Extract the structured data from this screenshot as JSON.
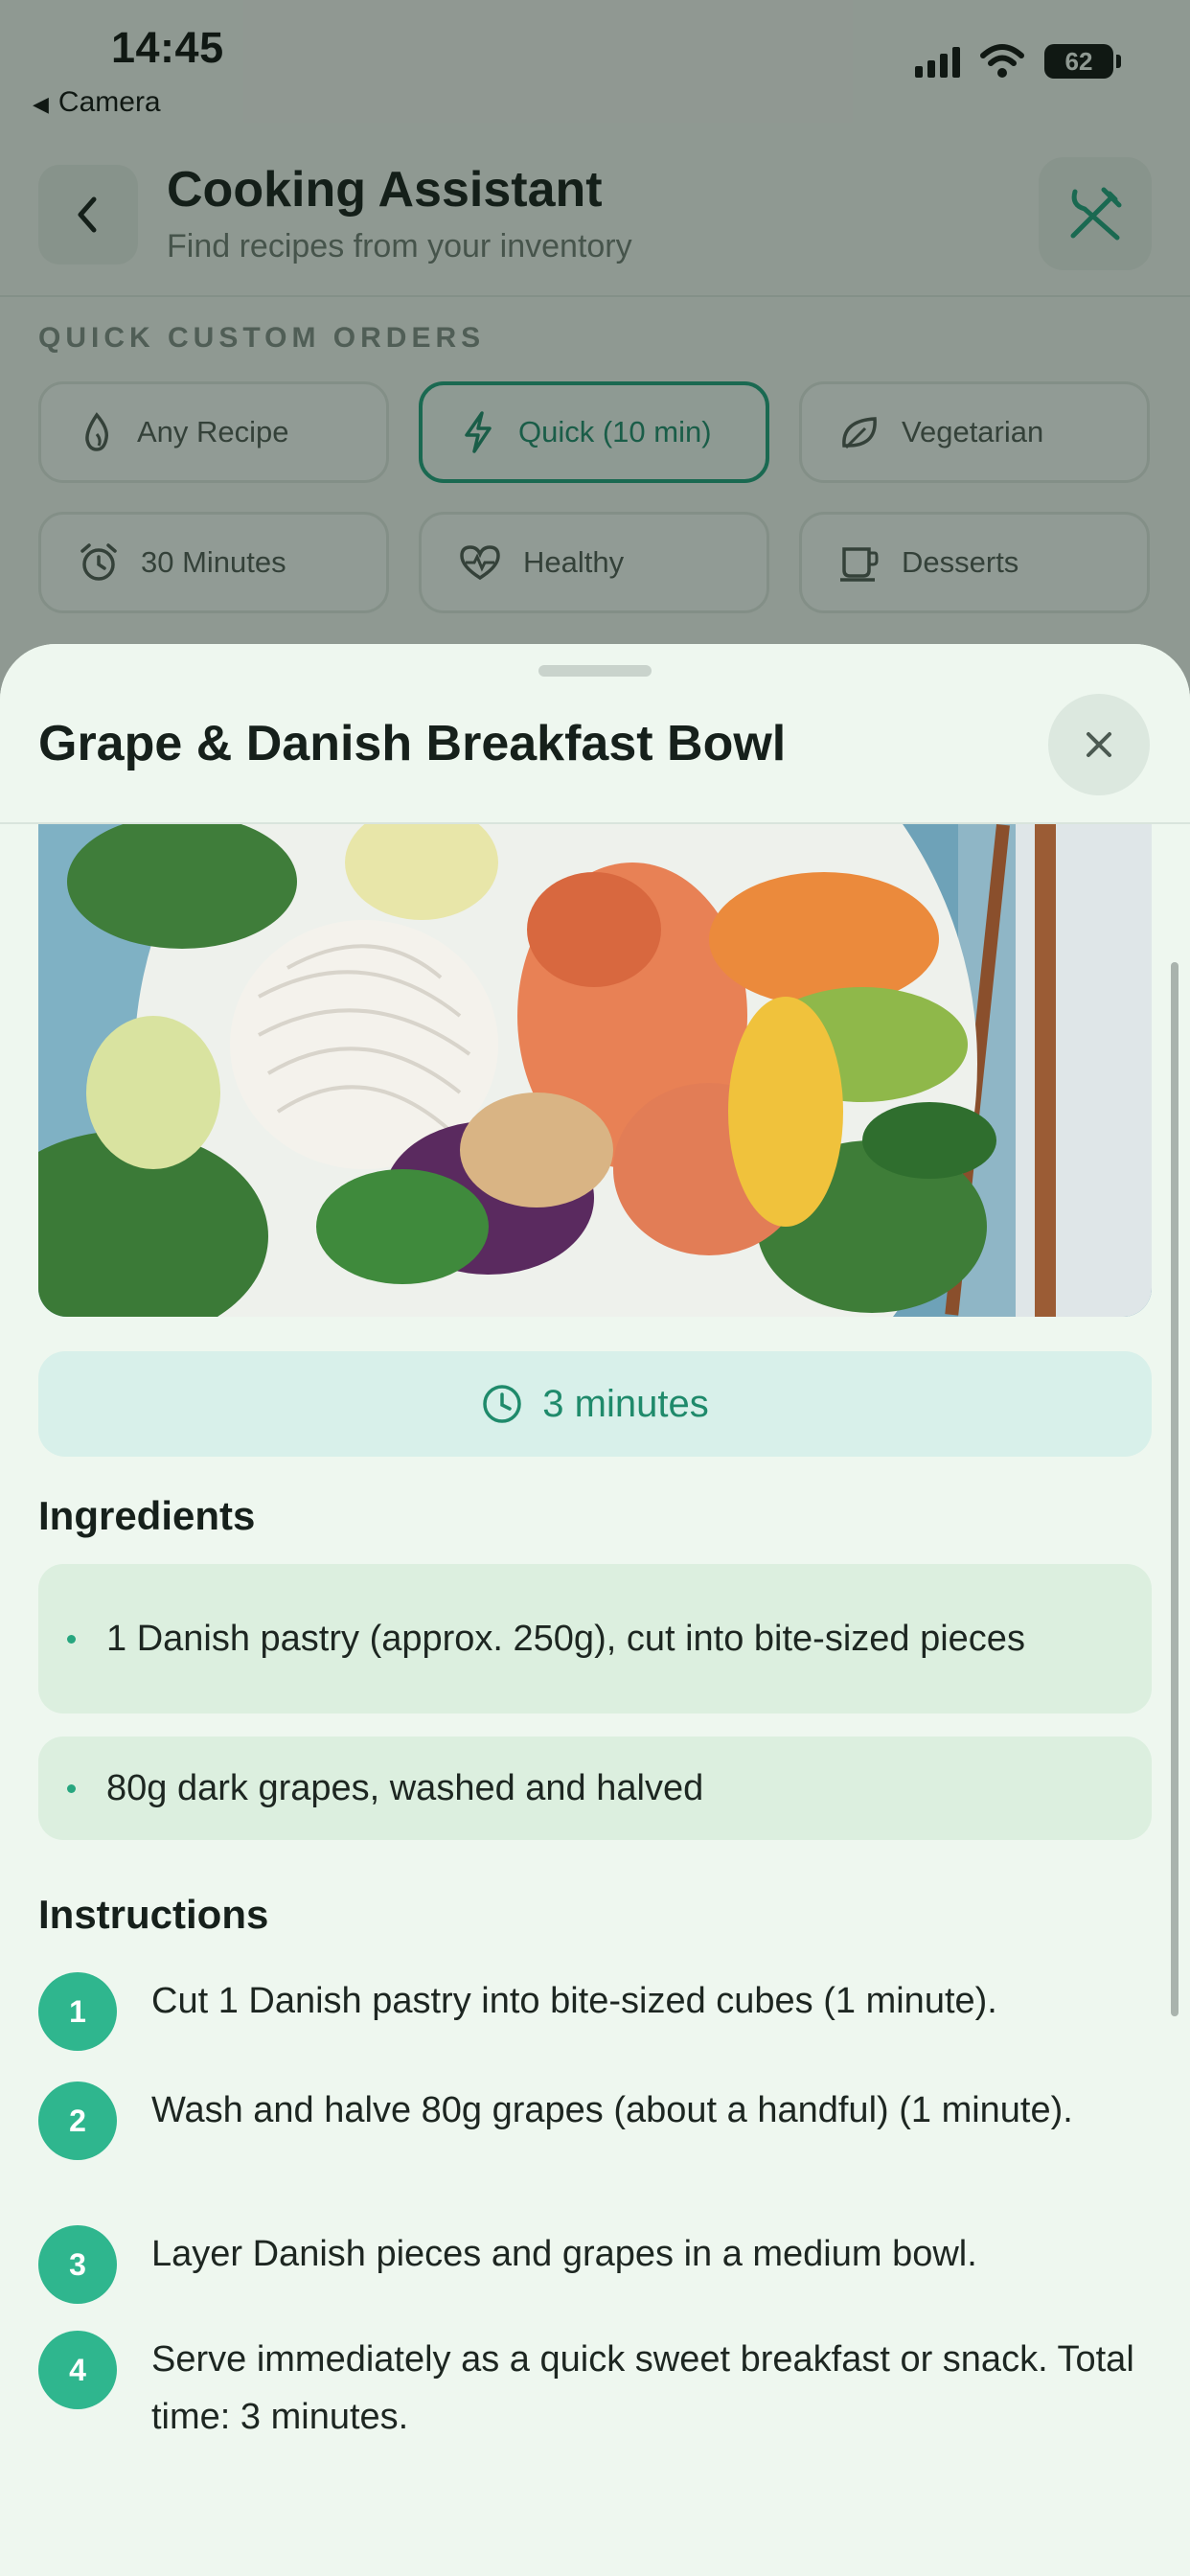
{
  "status_bar": {
    "time": "14:45",
    "back_label": "Camera",
    "battery": "62"
  },
  "header": {
    "title": "Cooking Assistant",
    "subtitle": "Find recipes from your inventory"
  },
  "quick_orders": {
    "label": "QUICK CUSTOM ORDERS",
    "chips": [
      {
        "label": "Any Recipe",
        "icon": "flame-icon",
        "active": false
      },
      {
        "label": "Quick (10 min)",
        "icon": "lightning-icon",
        "active": true
      },
      {
        "label": "Vegetarian",
        "icon": "leaf-icon",
        "active": false
      },
      {
        "label": "30 Minutes",
        "icon": "alarm-clock-icon",
        "active": false
      },
      {
        "label": "Healthy",
        "icon": "heart-pulse-icon",
        "active": false
      },
      {
        "label": "Desserts",
        "icon": "cup-icon",
        "active": false
      }
    ]
  },
  "recipe": {
    "title": "Grape & Danish Breakfast Bowl",
    "time": "3 minutes",
    "ingredients_heading": "Ingredients",
    "ingredients": [
      "1 Danish pastry (approx. 250g), cut into bite-sized pieces",
      "80g dark grapes, washed and halved"
    ],
    "instructions_heading": "Instructions",
    "steps": [
      {
        "num": "1",
        "text": "Cut 1 Danish pastry into bite-sized cubes (1 minute)."
      },
      {
        "num": "2",
        "text": "Wash and halve 80g grapes (about a handful) (1 minute)."
      },
      {
        "num": "3",
        "text": "Layer Danish pieces and grapes in a medium bowl."
      },
      {
        "num": "4",
        "text": "Serve immediately as a quick sweet breakfast or snack. Total time: 3 minutes."
      }
    ]
  },
  "colors": {
    "accent": "#1f9f7a",
    "step_badge": "#2fb68e",
    "sheet_bg": "#eef7ef"
  }
}
